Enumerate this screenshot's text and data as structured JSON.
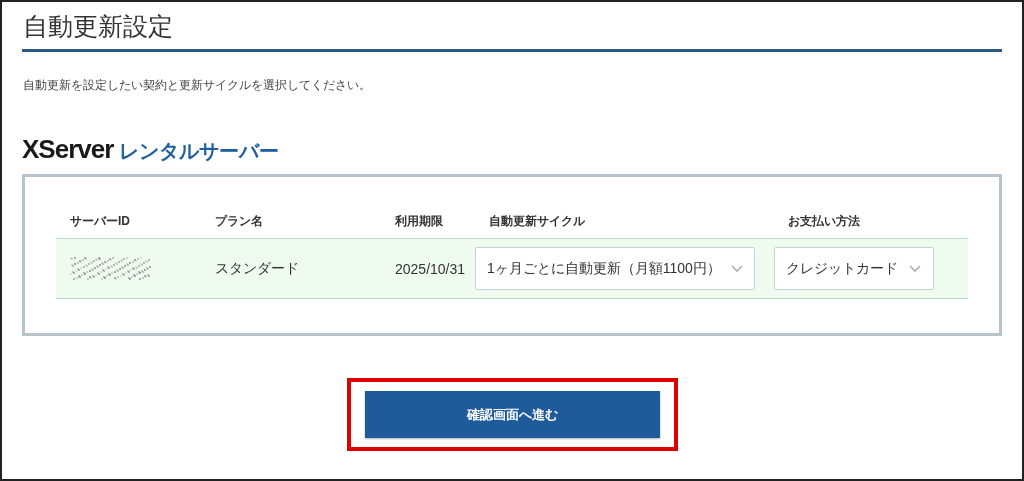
{
  "title": "自動更新設定",
  "description": "自動更新を設定したい契約と更新サイクルを選択してください。",
  "logo": {
    "brand": "XServer",
    "product": "レンタルサーバー"
  },
  "table": {
    "columns": [
      "サーバーID",
      "プラン名",
      "利用期限",
      "自動更新サイクル",
      "お支払い方法"
    ],
    "rows": [
      {
        "server_id": {
          "kind": "blurred"
        },
        "plan": "スタンダード",
        "expiry": "2025/10/31",
        "cycle": "1ヶ月ごとに自動更新（月額1100円）",
        "payment": "クレジットカード"
      }
    ]
  },
  "submit": {
    "label": "確認画面へ進む",
    "highlighted": true
  }
}
